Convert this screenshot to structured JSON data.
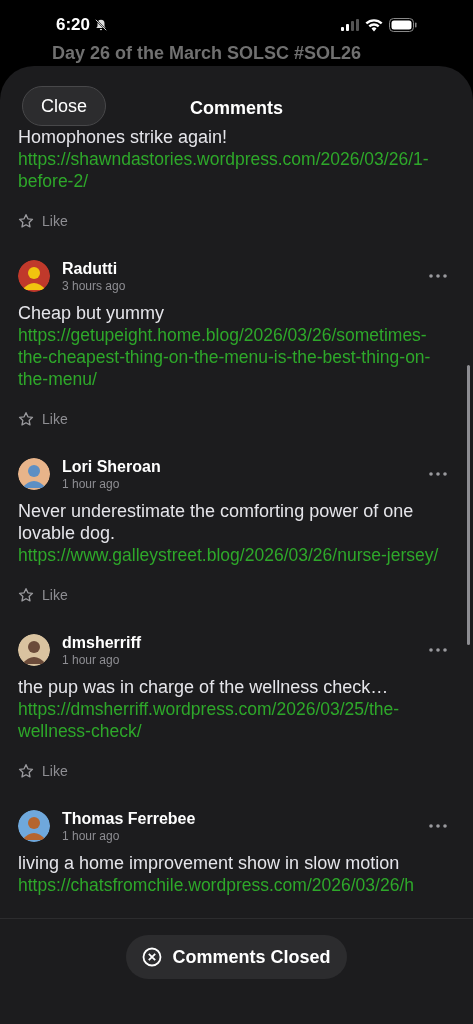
{
  "status_bar": {
    "time": "6:20"
  },
  "background": {
    "post_title": "Day 26 of the March SOLSC #SOL26"
  },
  "sheet": {
    "close_button": "Close",
    "title": "Comments"
  },
  "comments": [
    {
      "body": "Homophones strike again!",
      "link": "https://shawndastories.wordpress.com/2026/03/26/1-before-2/",
      "like_label": "Like"
    },
    {
      "author": "Radutti",
      "time": "3 hours ago",
      "body": "Cheap but yummy",
      "link": "https://getupeight.home.blog/2026/03/26/sometimes-the-cheapest-thing-on-the-menu-is-the-best-thing-on-the-menu/",
      "like_label": "Like"
    },
    {
      "author": "Lori Sheroan",
      "time": "1 hour ago",
      "body": "Never underestimate the comforting power of one lovable dog.",
      "link": "https://www.galleystreet.blog/2026/03/26/nurse-jersey/",
      "like_label": "Like"
    },
    {
      "author": "dmsherriff",
      "time": "1 hour ago",
      "body": "the pup was in charge of the wellness check…",
      "link": "https://dmsherriff.wordpress.com/2026/03/25/the-wellness-check/",
      "like_label": "Like"
    },
    {
      "author": "Thomas Ferrebee",
      "time": "1 hour ago",
      "body": "living a home improvement show in slow motion",
      "link": "https://chatsfromchile.wordpress.com/2026/03/26/h"
    }
  ],
  "footer": {
    "label": "Comments Closed"
  }
}
